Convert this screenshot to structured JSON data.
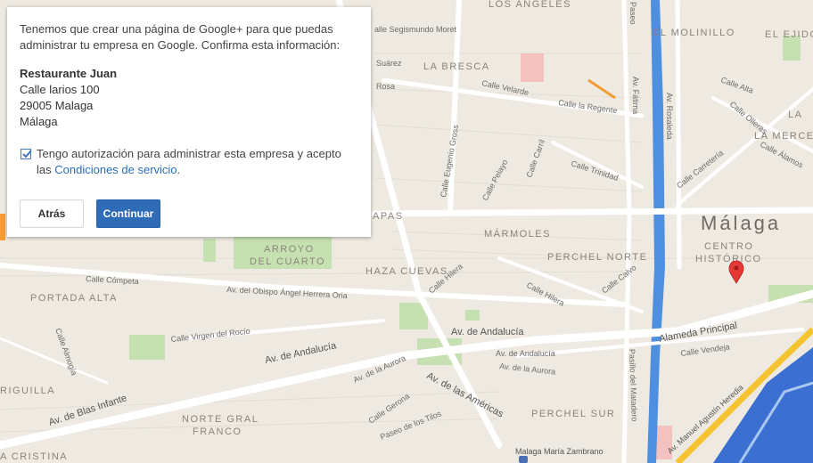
{
  "dialog": {
    "intro": "Tenemos que crear una página de Google+ para que puedas administrar tu empresa en Google. Confirma esta información:",
    "business_name": "Restaurante Juan",
    "street": "Calle larios 100",
    "postal_city": "29005 Malaga",
    "region": "Málaga",
    "consent_text": "Tengo autorización para administrar esta empresa y acepto las",
    "consent_link": "Condiciones de servicio",
    "consent_end": ".",
    "consent_checked": true,
    "back_label": "Atrás",
    "continue_label": "Continuar"
  },
  "map": {
    "city_label": "Málaga",
    "districts": {
      "bresca": "LA BRESCA",
      "molinillo": "EL MOLINILLO",
      "ejido": "EL EJIDO",
      "merced": "LA MERCED",
      "la": "LA",
      "centro1": "CENTRO",
      "centro2": "HISTÓRICO",
      "marmoles": "MÁRMOLES",
      "perchel_norte": "PERCHEL NORTE",
      "perchel_sur": "PERCHEL SUR",
      "arroyo1": "ARROYO",
      "arroyo2": "DEL CUARTO",
      "haza": "HAZA CUEVAS",
      "portada": "PORTADA ALTA",
      "norte1": "NORTE GRAL",
      "norte2": "FRANCO",
      "cristina": "A CRISTINA",
      "iguilla": "RIGUILLA",
      "apas": "APAS",
      "angeles": "LOS ANGELES"
    },
    "streets": {
      "segismundo": "alle Segismundo Moret",
      "suarez": "Suárez",
      "rosa": "Rosa",
      "velarde": "Calle Velarde",
      "regente": "Calle la Regente",
      "eugenio": "Calle Eugenio Gross",
      "pelayo": "Calle Pelayo",
      "carril": "Calle Carril",
      "trinidad": "Calle Trinidad",
      "fatima": "Av. Fátima",
      "rosaleda": "Av. Rosaleda",
      "paseo": "Paseo",
      "alta": "Calle Alta",
      "olleras": "Calle Olleras",
      "alamos": "Calle Álamos",
      "carreteria": "Calle Carretería",
      "competa": "Calle Cómpeta",
      "obispo": "Av. del Obispo Ángel Herrera Oria",
      "hilera": "Calle Hilera",
      "hilera2": "Calle Hilera",
      "calvo": "Calle Calvo",
      "andalucia1": "Av. de Andalucía",
      "andalucia2": "Av. de Andalucía",
      "andalucia3": "Av. de Andalucía",
      "alameda": "Alameda Principal",
      "vendeja": "Calle Vendeja",
      "heredia": "Av. Manuel Agustín Heredia",
      "virgen": "Calle Virgen del Rocío",
      "almogia": "Calle Almogía",
      "aurora": "Av. de la Aurora",
      "aurora2": "Av. de la Aurora",
      "americas": "Av. de las Américas",
      "blas": "Av. de Blas Infante",
      "gerona": "Calle Gerona",
      "tilos": "Paseo de los Tilos",
      "matadero": "Pasillo del Matadero",
      "zambrano": "Malaga María Zambrano"
    },
    "colors": {
      "land": "#eeeae2",
      "road": "#ffffff",
      "river": "#4f8fe0",
      "sea": "#3b6fd1",
      "park": "#bfdcaa",
      "highway": "#f4c430",
      "marker": "#e53935",
      "edge_orange": "#f39c34"
    }
  }
}
